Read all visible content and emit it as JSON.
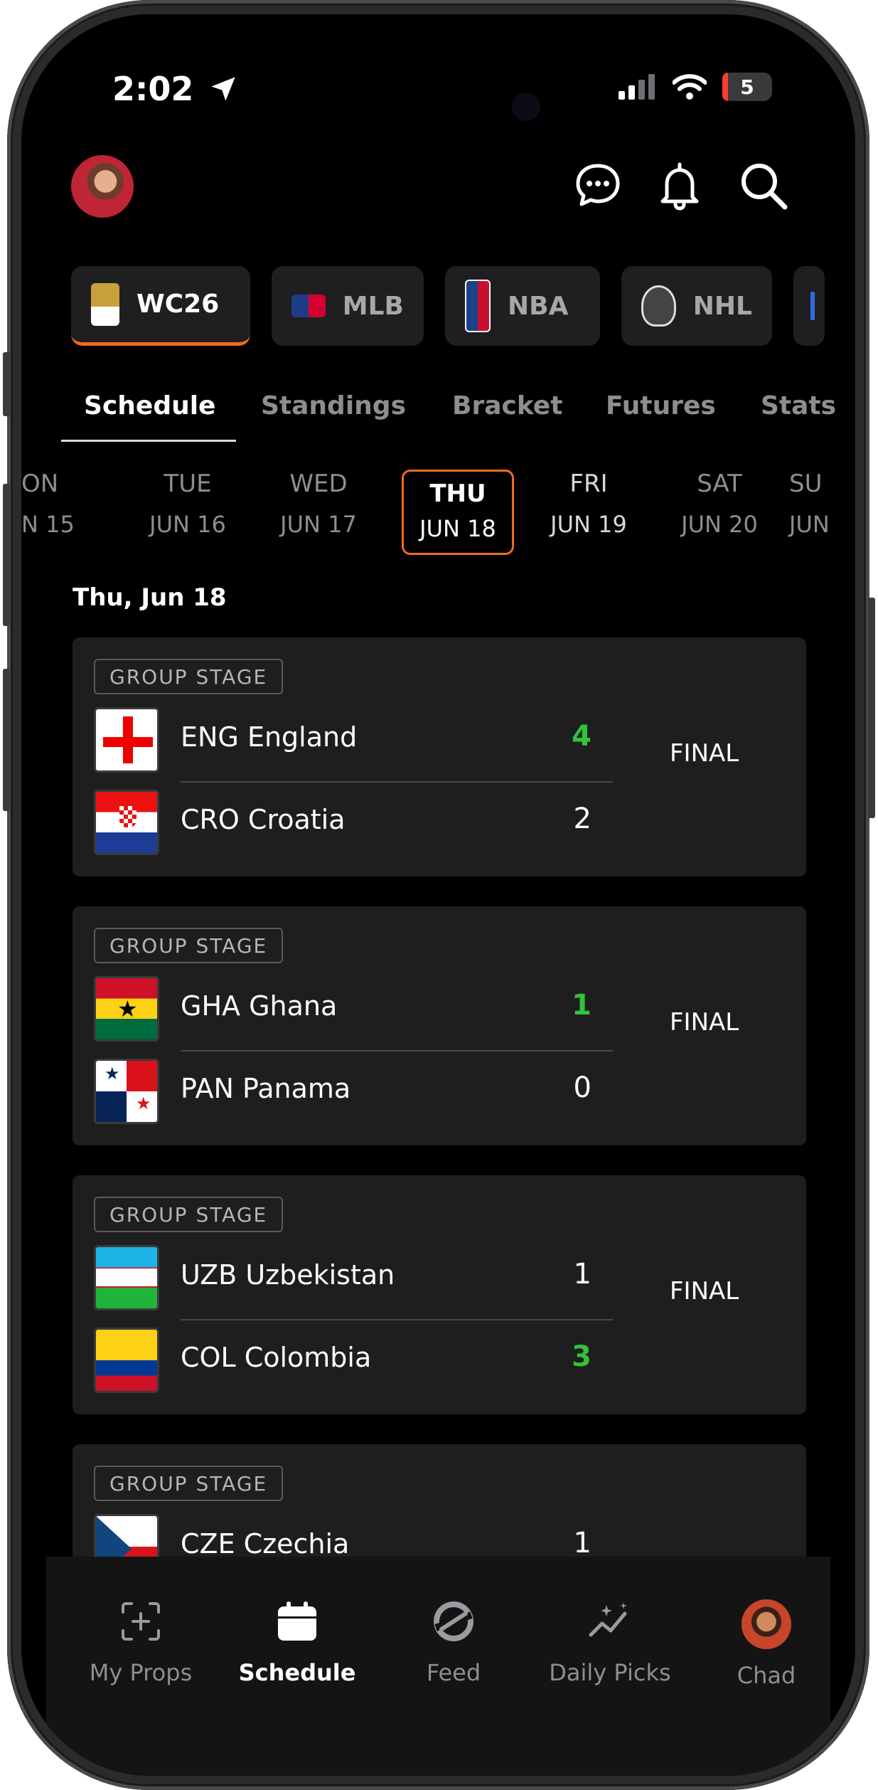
{
  "status_bar": {
    "time": "2:02",
    "battery": "5"
  },
  "leagues": [
    {
      "label": "WC26",
      "active": true
    },
    {
      "label": "MLB",
      "active": false
    },
    {
      "label": "NBA",
      "active": false
    },
    {
      "label": "NHL",
      "active": false
    }
  ],
  "tabs": [
    "Schedule",
    "Standings",
    "Bracket",
    "Futures",
    "Stats"
  ],
  "dates": [
    {
      "dow": "ON",
      "dm": "N 15"
    },
    {
      "dow": "TUE",
      "dm": "JUN 16"
    },
    {
      "dow": "WED",
      "dm": "JUN 17"
    },
    {
      "dow": "THU",
      "dm": "JUN 18",
      "selected": true
    },
    {
      "dow": "FRI",
      "dm": "JUN 19"
    },
    {
      "dow": "SAT",
      "dm": "JUN 20"
    },
    {
      "dow": "SU",
      "dm": "JUN"
    }
  ],
  "day_heading": "Thu, Jun 18",
  "matches": [
    {
      "stage": "GROUP STAGE",
      "status": "FINAL",
      "home": {
        "name": "ENG England",
        "score": "4"
      },
      "away": {
        "name": "CRO Croatia",
        "score": "2"
      }
    },
    {
      "stage": "GROUP STAGE",
      "status": "FINAL",
      "home": {
        "name": "GHA Ghana",
        "score": "1"
      },
      "away": {
        "name": "PAN Panama",
        "score": "0"
      }
    },
    {
      "stage": "GROUP STAGE",
      "status": "FINAL",
      "home": {
        "name": "UZB Uzbekistan",
        "score": "1"
      },
      "away": {
        "name": "COL Colombia",
        "score": "3"
      }
    },
    {
      "stage": "GROUP STAGE",
      "home": {
        "name": "CZE Czechia",
        "score": "1"
      }
    }
  ],
  "bottom_nav": [
    "My Props",
    "Schedule",
    "Feed",
    "Daily Picks",
    "Chad"
  ],
  "colors": {
    "accent": "#f26b1d",
    "win": "#33c23a",
    "card": "#1e1e1f"
  }
}
